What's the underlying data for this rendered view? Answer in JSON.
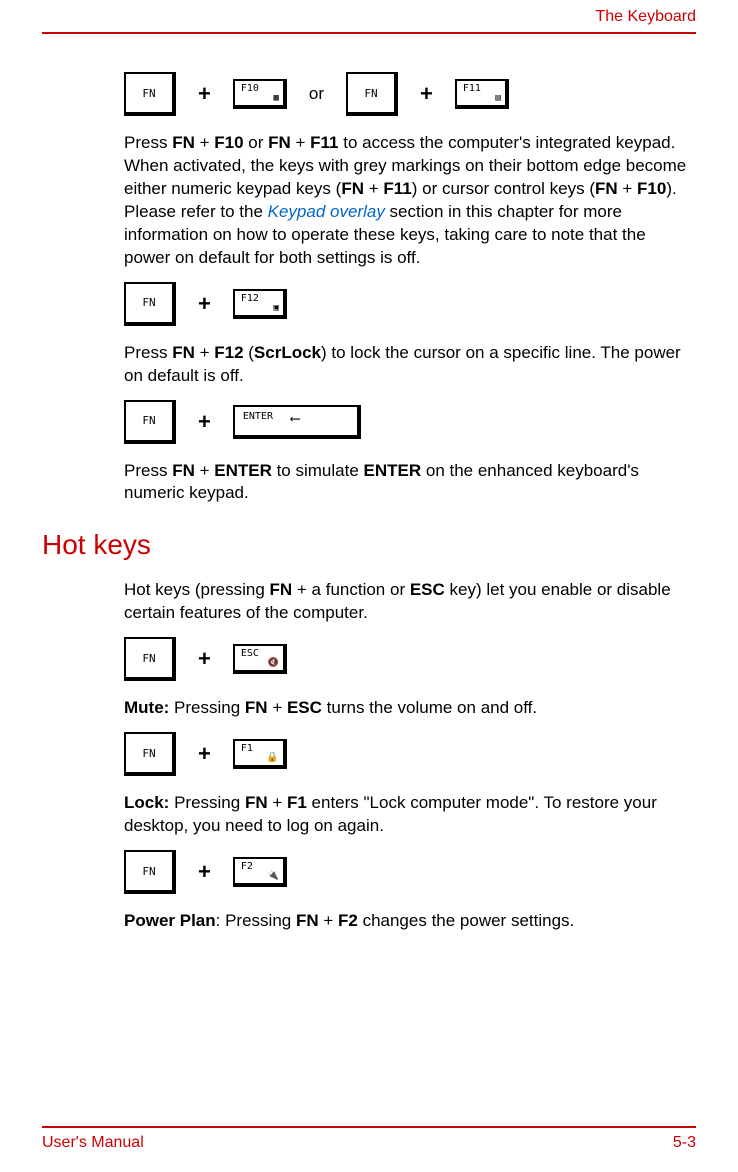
{
  "header": {
    "title": "The Keyboard"
  },
  "keys": {
    "fn": "FN",
    "f10": "F10",
    "f11": "F11",
    "f12": "F12",
    "esc": "ESC",
    "f1": "F1",
    "f2": "F2",
    "enter": "ENTER"
  },
  "labels": {
    "or": "or",
    "plus": "+"
  },
  "para1": {
    "t1": "Press ",
    "b1": "FN",
    "t2": " + ",
    "b2": "F10",
    "t3": " or ",
    "b3": "FN",
    "t4": " + ",
    "b4": "F11",
    "t5": " to access the computer's integrated keypad. When activated, the keys with grey markings on their bottom edge become either numeric keypad keys (",
    "b5": "FN",
    "t6": " + ",
    "b6": "F11",
    "t7": ") or cursor control keys (",
    "b7": "FN",
    "t8": " + ",
    "b8": "F10",
    "t9": "). Please refer to the ",
    "link": "Keypad overlay",
    "t10": " section in this chapter for more information on how to operate these keys, taking care to note that the power on default for both settings is off."
  },
  "para2": {
    "t1": "Press ",
    "b1": "FN",
    "t2": " + ",
    "b2": "F12",
    "t3": " (",
    "b3": "ScrLock",
    "t4": ") to lock the cursor on a specific line. The power on default is off."
  },
  "para3": {
    "t1": "Press ",
    "b1": "FN",
    "t2": " + ",
    "b2": "ENTER",
    "t3": " to simulate ",
    "b3": "ENTER",
    "t4": " on the enhanced keyboard's numeric keypad."
  },
  "section": {
    "hotkeys": "Hot keys"
  },
  "para4": {
    "t1": "Hot keys (pressing ",
    "b1": "FN",
    "t2": " + a function or ",
    "b2": "ESC",
    "t3": " key) let you enable or disable certain features of the computer."
  },
  "para5": {
    "b1": "Mute:",
    "t1": " Pressing ",
    "b2": "FN",
    "t2": " + ",
    "b3": "ESC",
    "t3": " turns the volume on and off."
  },
  "para6": {
    "b1": "Lock:",
    "t1": " Pressing ",
    "b2": "FN",
    "t2": " + ",
    "b3": "F1",
    "t3": " enters \"Lock computer mode\". To restore your desktop, you need to log on again."
  },
  "para7": {
    "b1": "Power Plan",
    "t1": ": Pressing ",
    "b2": "FN",
    "t2": " + ",
    "b3": "F2",
    "t3": " changes the power settings."
  },
  "footer": {
    "left": "User's Manual",
    "right": "5-3"
  }
}
